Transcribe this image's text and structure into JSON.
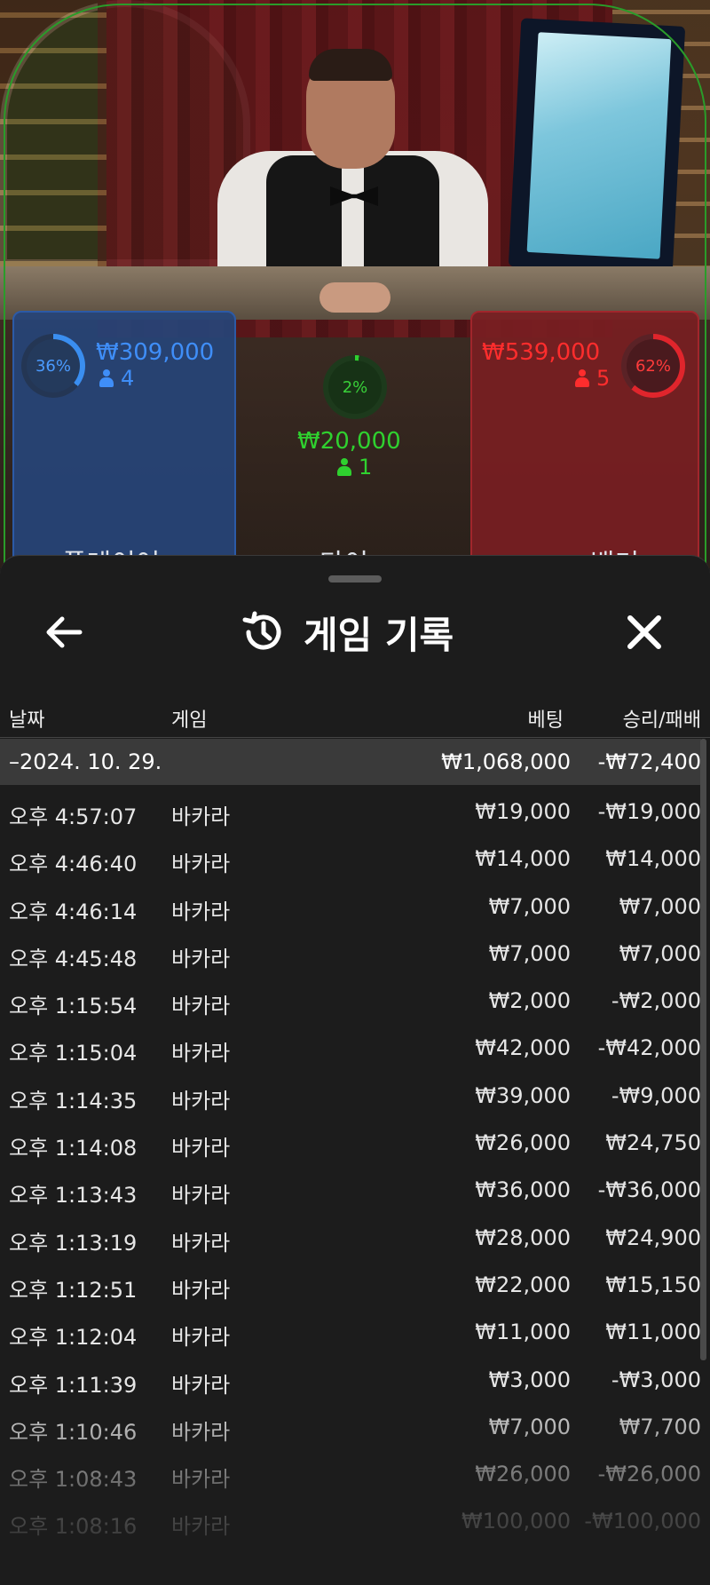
{
  "stage": {
    "player": {
      "percent": "36%",
      "amount": "₩309,000",
      "count": "4",
      "label": "플레이어"
    },
    "tie": {
      "percent": "2%",
      "amount": "₩20,000",
      "count": "1",
      "label": "타이"
    },
    "banker": {
      "percent": "62%",
      "amount": "₩539,000",
      "count": "5",
      "label": "뱅커"
    },
    "colors": {
      "player": "#3f8ef8",
      "tie": "#2fd12f",
      "banker": "#ff2d2d"
    }
  },
  "sheet": {
    "title": "게임 기록",
    "icons": {
      "back": "arrow-left-icon",
      "history": "history-icon",
      "close": "close-icon"
    },
    "columns": {
      "date": "날짜",
      "game": "게임",
      "bet": "베팅",
      "result": "승리/패배"
    },
    "date_group": {
      "date": "–2024. 10. 29.",
      "bet_total": "₩1,068,000",
      "result_total": "-₩72,400"
    },
    "rows": [
      {
        "time": "오후 4:57:07",
        "game": "바카라",
        "bet": "₩19,000",
        "result": "-₩19,000"
      },
      {
        "time": "오후 4:46:40",
        "game": "바카라",
        "bet": "₩14,000",
        "result": "₩14,000"
      },
      {
        "time": "오후 4:46:14",
        "game": "바카라",
        "bet": "₩7,000",
        "result": "₩7,000"
      },
      {
        "time": "오후 4:45:48",
        "game": "바카라",
        "bet": "₩7,000",
        "result": "₩7,000"
      },
      {
        "time": "오후 1:15:54",
        "game": "바카라",
        "bet": "₩2,000",
        "result": "-₩2,000"
      },
      {
        "time": "오후 1:15:04",
        "game": "바카라",
        "bet": "₩42,000",
        "result": "-₩42,000"
      },
      {
        "time": "오후 1:14:35",
        "game": "바카라",
        "bet": "₩39,000",
        "result": "-₩9,000"
      },
      {
        "time": "오후 1:14:08",
        "game": "바카라",
        "bet": "₩26,000",
        "result": "₩24,750"
      },
      {
        "time": "오후 1:13:43",
        "game": "바카라",
        "bet": "₩36,000",
        "result": "-₩36,000"
      },
      {
        "time": "오후 1:13:19",
        "game": "바카라",
        "bet": "₩28,000",
        "result": "₩24,900"
      },
      {
        "time": "오후 1:12:51",
        "game": "바카라",
        "bet": "₩22,000",
        "result": "₩15,150"
      },
      {
        "time": "오후 1:12:04",
        "game": "바카라",
        "bet": "₩11,000",
        "result": "₩11,000"
      },
      {
        "time": "오후 1:11:39",
        "game": "바카라",
        "bet": "₩3,000",
        "result": "-₩3,000"
      },
      {
        "time": "오후 1:10:46",
        "game": "바카라",
        "bet": "₩7,000",
        "result": "₩7,700"
      },
      {
        "time": "오후 1:08:43",
        "game": "바카라",
        "bet": "₩26,000",
        "result": "-₩26,000"
      },
      {
        "time": "오후 1:08:16",
        "game": "바카라",
        "bet": "₩100,000",
        "result": "-₩100,000"
      }
    ]
  }
}
